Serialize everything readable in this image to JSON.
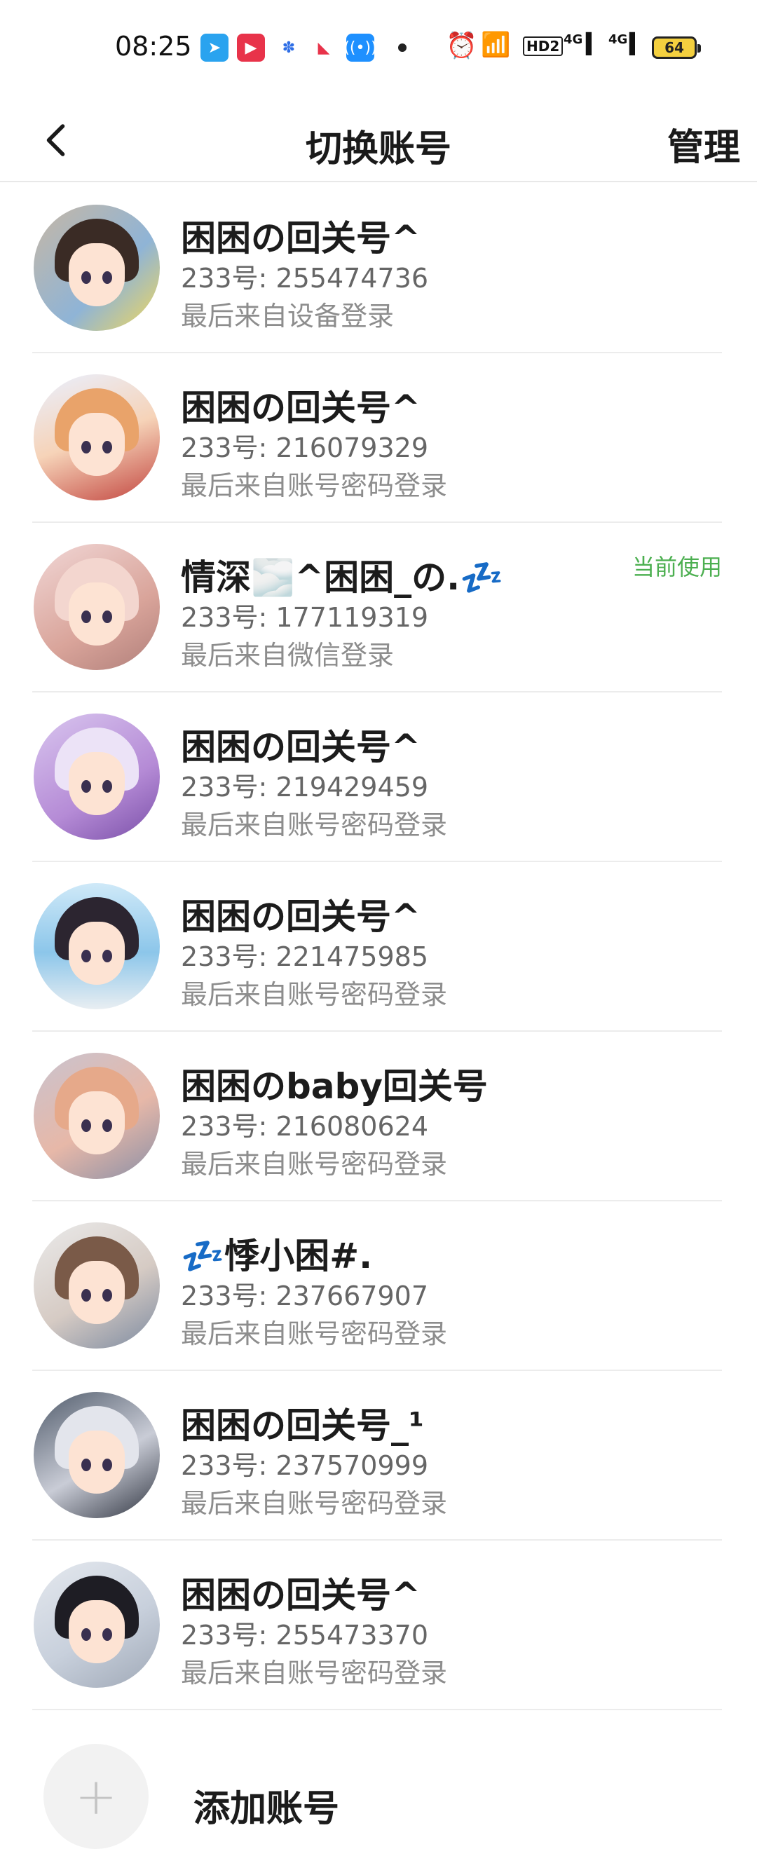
{
  "status_bar": {
    "time": "08:25",
    "signal_1": "4G",
    "signal_2": "4G",
    "hd_label": "HD2",
    "battery": "64"
  },
  "header": {
    "title": "切换账号",
    "manage_label": "管理"
  },
  "accounts": [
    {
      "name": "困困の回关号^",
      "id": "233号: 255474736",
      "login": "最后来自设备登录",
      "current": ""
    },
    {
      "name": "困困の回关号^",
      "id": "233号: 216079329",
      "login": "最后来自账号密码登录",
      "current": ""
    },
    {
      "name": "情深🌫️^困困_の.💤",
      "id": "233号: 177119319",
      "login": "最后来自微信登录",
      "current": "当前使用"
    },
    {
      "name": "困困の回关号^",
      "id": "233号: 219429459",
      "login": "最后来自账号密码登录",
      "current": ""
    },
    {
      "name": "困困の回关号^",
      "id": "233号: 221475985",
      "login": "最后来自账号密码登录",
      "current": ""
    },
    {
      "name": "困困のbaby回关号",
      "id": "233号: 216080624",
      "login": "最后来自账号密码登录",
      "current": ""
    },
    {
      "name": "💤悸小困#.",
      "id": "233号: 237667907",
      "login": "最后来自账号密码登录",
      "current": ""
    },
    {
      "name": "困困の回关号_¹",
      "id": "233号: 237570999",
      "login": "最后来自账号密码登录",
      "current": ""
    },
    {
      "name": "困困の回关号^",
      "id": "233号: 255473370",
      "login": "最后来自账号密码登录",
      "current": ""
    }
  ],
  "add_account": {
    "plus": "+",
    "label": "添加账号"
  },
  "colors": {
    "current_badge": "#4caf50",
    "divider": "#ececec"
  }
}
